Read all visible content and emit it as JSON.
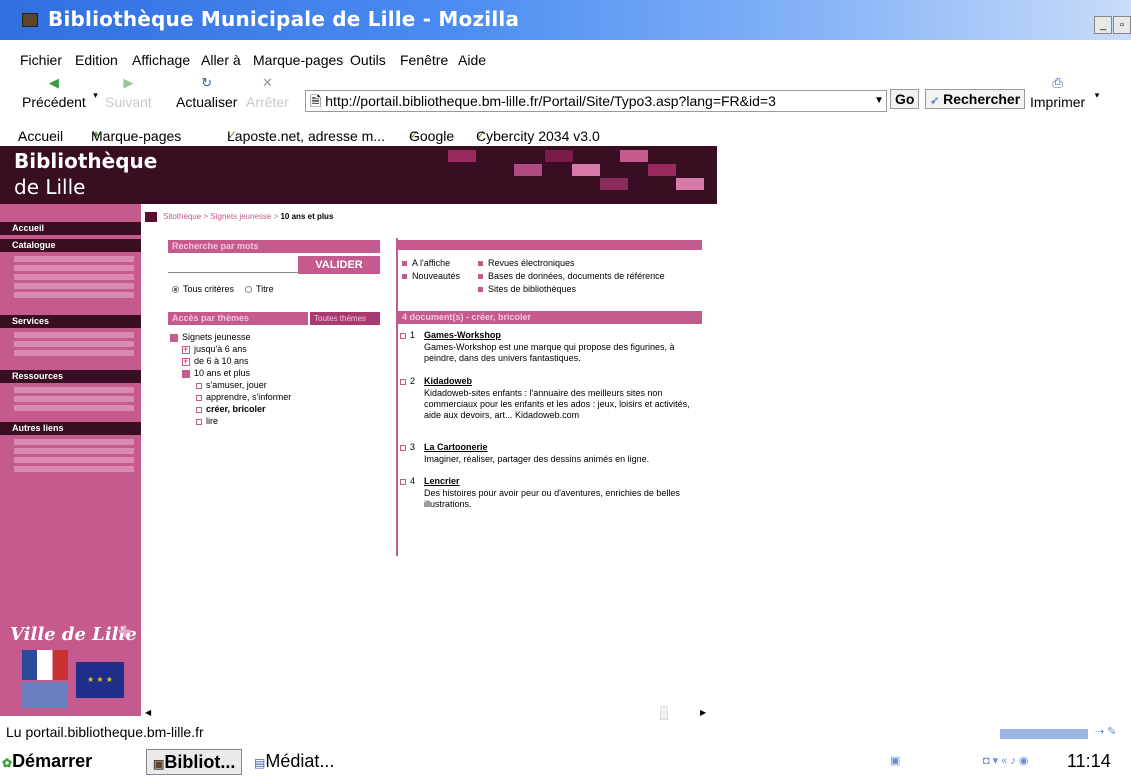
{
  "window": {
    "title": "Bibliothèque Municipale de Lille - Mozilla",
    "minimize": "_",
    "restore": "▫"
  },
  "menu": {
    "items": [
      "Fichier",
      "Edition",
      "Affichage",
      "Aller à",
      "Marque-pages",
      "Outils",
      "Fenêtre",
      "Aide"
    ]
  },
  "toolbar": {
    "back": "Précédent",
    "forward": "Suivant",
    "reload": "Actualiser",
    "stop": "Arrêter",
    "url": "http://portail.bibliotheque.bm-lille.fr/Portail/Site/Typo3.asp?lang=FR&id=3",
    "go": "Go",
    "search": "Rechercher",
    "print": "Imprimer"
  },
  "bookmarks": {
    "items": [
      "Accueil",
      "Marque-pages",
      "Laposte.net, adresse m...",
      "Google",
      "Cybercity 2034 v3.0"
    ]
  },
  "site": {
    "title": "Bibliothèque",
    "subtitle": "de Lille",
    "colors": {
      "accent": "#c45a8d",
      "dark": "#3a0e22"
    }
  },
  "sidebar": {
    "sections": [
      "Accueil",
      "Catalogue",
      "Services",
      "Ressources",
      "Autres liens"
    ],
    "city": "Ville de Lille"
  },
  "breadcrumb": {
    "part1": "Sitothèque",
    "part2": "Signets jeunesse",
    "sep": ">",
    "current": "10 ans et plus"
  },
  "search": {
    "title": "Recherche par mots",
    "button": "VALIDER",
    "option1": "Tous critères",
    "option2": "Titre"
  },
  "themes": {
    "title": "Accès par thèmes",
    "all_button": "Toutes thèmes",
    "root": "Signets jeunesse",
    "items": [
      "jusqu'à 6 ans",
      "de 6 à 10 ans",
      "10 ans et plus"
    ],
    "subitems": [
      "s'amuser, jouer",
      "apprendre, s'informer",
      "créer, bricoler",
      "lire"
    ]
  },
  "right_links": {
    "col1": [
      "A l'affiche",
      "Nouveautés"
    ],
    "col2": [
      "Revues électroniques",
      "Bases de données, documents de référence",
      "Sites de bibliothèques"
    ]
  },
  "results": {
    "title": "4 document(s) - créer, bricoler",
    "docs": [
      {
        "num": "1",
        "title": "Games-Workshop",
        "desc": "Games-Workshop est une marque qui propose des figurines, à peindre, dans des univers fantastiques."
      },
      {
        "num": "2",
        "title": "Kidadoweb",
        "desc": "Kidadoweb-sites enfants : l'annuaire des meilleurs sites non commerciaux pour les enfants et les ados : jeux, loisirs et activités, aide aux devoirs, art... Kidadoweb.com"
      },
      {
        "num": "3",
        "title": "La Cartoonerie",
        "desc": "Imaginer, réaliser, partager des dessins animés en ligne."
      },
      {
        "num": "4",
        "title": "Lencrier",
        "desc": "Des histoires pour avoir peur ou d'aventures, enrichies de belles illustrations."
      }
    ]
  },
  "status": {
    "text": "Lu portail.bibliotheque.bm-lille.fr"
  },
  "taskbar": {
    "start": "Démarrer",
    "task1": "Bibliot...",
    "task2": "Médiat...",
    "clock": "11:14"
  }
}
